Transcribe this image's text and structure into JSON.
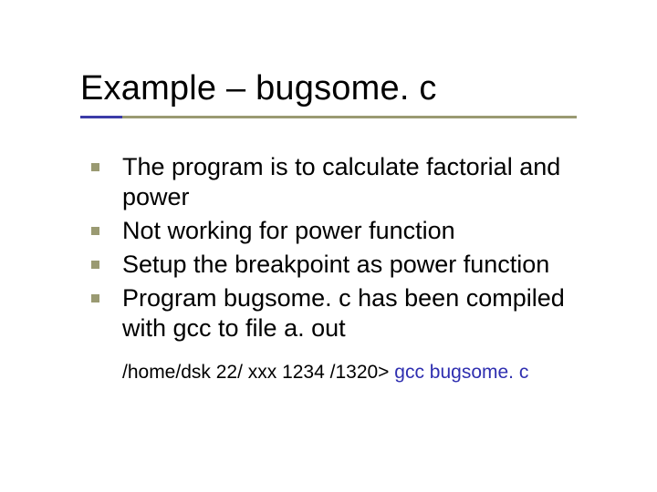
{
  "title": "Example – bugsome. c",
  "bullets": [
    "The program is to calculate factorial and power",
    "Not working for power function",
    "Setup the breakpoint as power function",
    "Program bugsome. c has been compiled with gcc to file a. out"
  ],
  "command": {
    "prompt": "/home/dsk 22/ xxx 1234 /1320> ",
    "cmd": "gcc bugsome. c"
  }
}
